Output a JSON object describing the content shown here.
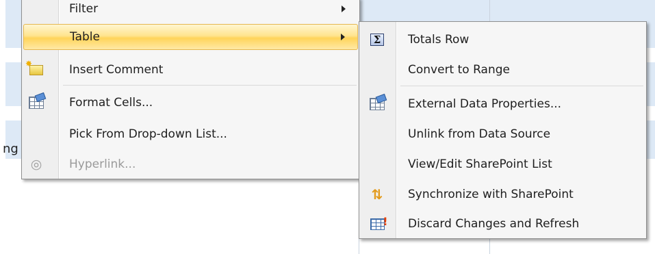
{
  "sheet": {
    "partial_cell_text": "ng"
  },
  "context_menu": {
    "items": [
      {
        "label": "Filter",
        "icon": "none",
        "has_submenu": true
      },
      {
        "label": "Table",
        "icon": "none",
        "has_submenu": true,
        "highlighted": true
      },
      {
        "label": "Insert Comment",
        "icon": "insert-comment-icon"
      },
      {
        "label": "Format Cells...",
        "icon": "format-cells-icon"
      },
      {
        "label": "Pick From Drop-down List...",
        "icon": "none"
      },
      {
        "label": "Hyperlink...",
        "icon": "hyperlink-icon",
        "disabled": true
      }
    ],
    "highlight_color": "#ffd45a"
  },
  "table_submenu": {
    "items": [
      {
        "label": "Totals Row",
        "icon": "sigma-icon"
      },
      {
        "label": "Convert to Range",
        "icon": "none"
      },
      {
        "label": "External Data Properties...",
        "icon": "properties-icon"
      },
      {
        "label": "Unlink from Data Source",
        "icon": "none"
      },
      {
        "label": "View/Edit SharePoint List",
        "icon": "none"
      },
      {
        "label": "Synchronize with SharePoint",
        "icon": "synchronize-icon"
      },
      {
        "label": "Discard Changes and Refresh",
        "icon": "discard-changes-icon"
      }
    ]
  }
}
